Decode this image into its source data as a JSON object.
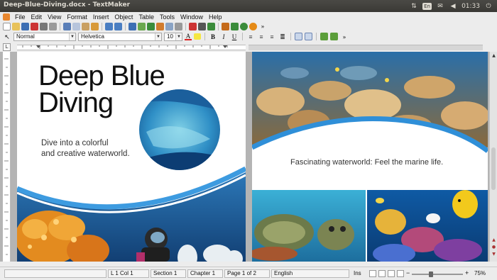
{
  "window": {
    "title": "Deep-Blue-Diving.docx - TextMaker"
  },
  "tray": {
    "lang": "En",
    "time": "01:33"
  },
  "menu": [
    "File",
    "Edit",
    "View",
    "Format",
    "Insert",
    "Object",
    "Table",
    "Tools",
    "Window",
    "Help"
  ],
  "format_bar": {
    "style": "Normal",
    "font": "Helvetica",
    "size": "10",
    "bold": "B",
    "italic": "I",
    "underline": "U"
  },
  "ruler": {
    "corner": "L"
  },
  "page1": {
    "title_line1": "Deep Blue",
    "title_line2": "Diving",
    "subtitle_line1": "Dive into a colorful",
    "subtitle_line2": "and creative waterworld."
  },
  "page2": {
    "tagline": "Fascinating waterworld: Feel the marine life."
  },
  "status": {
    "position": "L 1 Col 1",
    "section": "Section 1",
    "chapter": "Chapter 1",
    "page": "Page 1 of 2",
    "language": "English",
    "mode": "Ins",
    "zoom": "75%"
  },
  "colors": {
    "accent_blue": "#2f8fd8",
    "ocean_deep": "#1d5e9a"
  }
}
